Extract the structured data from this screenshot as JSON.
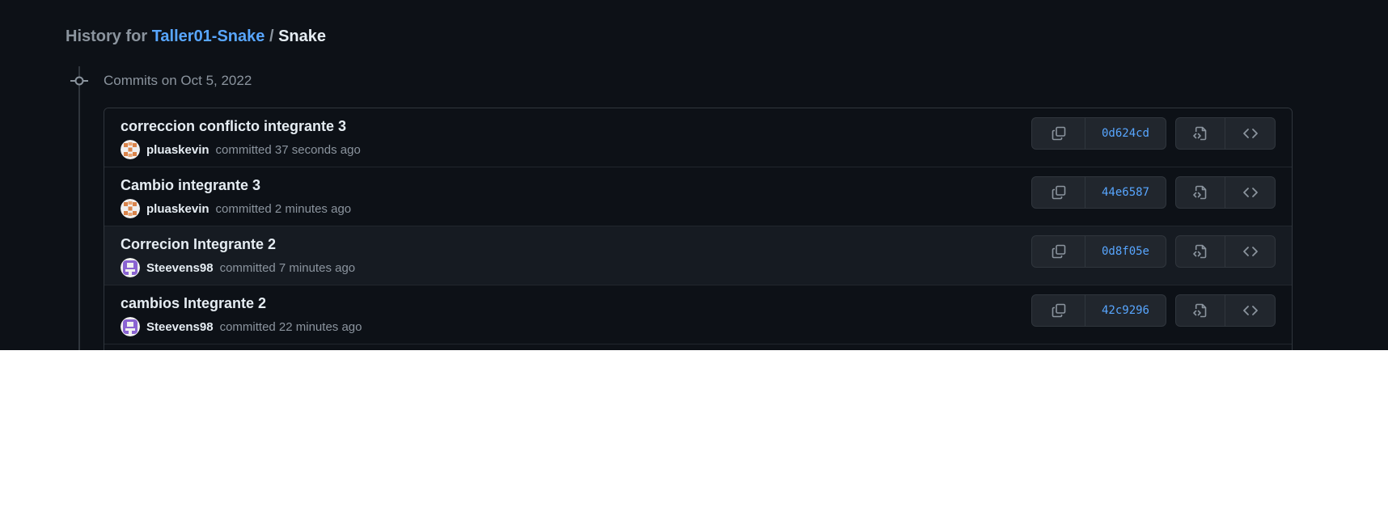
{
  "header": {
    "prefix": "History for",
    "repo": "Taller01-Snake",
    "separator": "/",
    "file": "Snake"
  },
  "timeline": {
    "date_heading": "Commits on Oct 5, 2022"
  },
  "commits": [
    {
      "message": "correccion conflicto integrante 3",
      "author": "pluaskevin",
      "time": "committed 37 seconds ago",
      "sha": "0d624cd",
      "avatar": "avatar-orange"
    },
    {
      "message": "Cambio integrante 3",
      "author": "pluaskevin",
      "time": "committed 2 minutes ago",
      "sha": "44e6587",
      "avatar": "avatar-orange"
    },
    {
      "message": "Correcion Integrante 2",
      "author": "Steevens98",
      "time": "committed 7 minutes ago",
      "sha": "0d8f05e",
      "avatar": "avatar-purple"
    },
    {
      "message": "cambios Integrante 2",
      "author": "Steevens98",
      "time": "committed 22 minutes ago",
      "sha": "42c9296",
      "avatar": "avatar-purple"
    }
  ],
  "icons": {
    "commit": "git-commit-icon",
    "copy": "copy-icon",
    "browse": "file-code-icon",
    "code": "code-icon"
  },
  "colors": {
    "background": "#0d1117",
    "link": "#58a6ff",
    "text": "#e6edf3",
    "muted": "#8b949e",
    "border": "#30363d"
  }
}
